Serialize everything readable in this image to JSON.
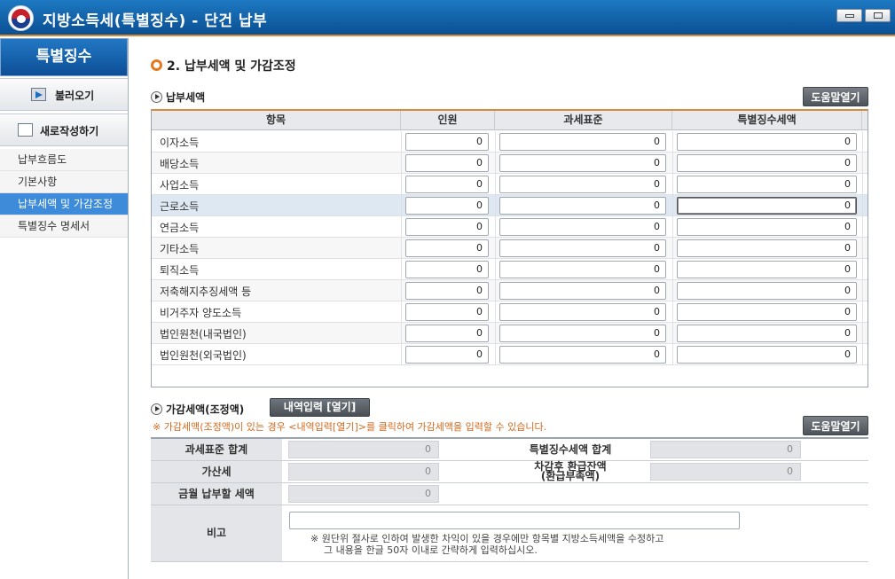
{
  "window": {
    "title": "지방소득세(특별징수) - 단건 납부"
  },
  "sidebar": {
    "header": "특별징수",
    "load_button": "불러오기",
    "new_button": "새로작성하기",
    "items": [
      {
        "label": "납부흐름도",
        "active": false
      },
      {
        "label": "기본사항",
        "active": false
      },
      {
        "label": "납부세액 및 가감조정",
        "active": true
      },
      {
        "label": "특별징수 명세서",
        "active": false
      }
    ]
  },
  "main": {
    "section_title": "2. 납부세액 및 가감조정",
    "payment": {
      "heading": "납부세액",
      "help_label": "도움말열기",
      "columns": [
        "항목",
        "인원",
        "과세표준",
        "특별징수세액"
      ],
      "rows": [
        {
          "label": "이자소득",
          "count": "0",
          "base": "0",
          "tax": "0"
        },
        {
          "label": "배당소득",
          "count": "0",
          "base": "0",
          "tax": "0"
        },
        {
          "label": "사업소득",
          "count": "0",
          "base": "0",
          "tax": "0"
        },
        {
          "label": "근로소득",
          "count": "0",
          "base": "0",
          "tax": "0"
        },
        {
          "label": "연금소득",
          "count": "0",
          "base": "0",
          "tax": "0"
        },
        {
          "label": "기타소득",
          "count": "0",
          "base": "0",
          "tax": "0"
        },
        {
          "label": "퇴직소득",
          "count": "0",
          "base": "0",
          "tax": "0"
        },
        {
          "label": "저축해지추징세액 등",
          "count": "0",
          "base": "0",
          "tax": "0"
        },
        {
          "label": "비거주자 양도소득",
          "count": "0",
          "base": "0",
          "tax": "0"
        },
        {
          "label": "법인원천(내국법인)",
          "count": "0",
          "base": "0",
          "tax": "0"
        },
        {
          "label": "법인원천(외국법인)",
          "count": "0",
          "base": "0",
          "tax": "0"
        }
      ]
    },
    "adjustment": {
      "heading": "가감세액(조정액)",
      "detail_button": "내역입력 [열기]",
      "notice": "※ 가감세액(조정액)이 있는 경우 <내역입력[열기]>를 클릭하여 가감세액을 입력할 수 있습니다.",
      "help_label": "도움말열기",
      "tax_base_total_label": "과세표준 합계",
      "tax_base_total": "0",
      "special_tax_total_label": "특별징수세액 합계",
      "special_tax_total": "0",
      "additional_tax_label": "가산세",
      "additional_tax": "0",
      "refund_balance_label_1": "차감후 환급잔액",
      "refund_balance_label_2": "(환급부족액)",
      "refund_balance": "0",
      "month_payable_label": "금월 납부할 세액",
      "month_payable": "0",
      "memo_label": "비고",
      "memo_note_1": "※ 원단위 절사로 인하여 발생한 차익이 있을 경우에만 항목별 지방소득세액을 수정하고",
      "memo_note_2": "그 내용을 한글 50자 이내로 간략하게 입력하십시오."
    }
  }
}
